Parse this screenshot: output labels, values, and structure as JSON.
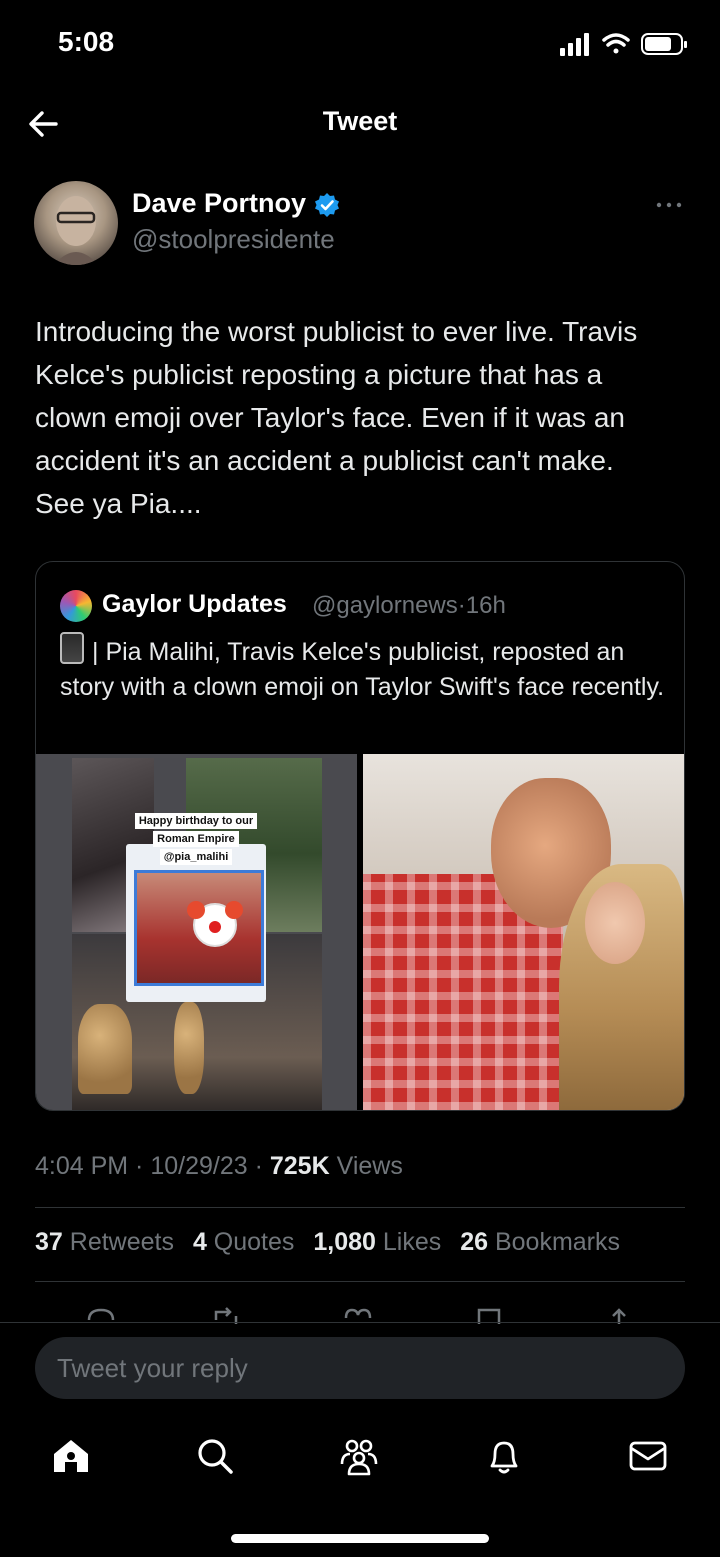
{
  "status_bar": {
    "time": "5:08"
  },
  "header": {
    "title": "Tweet"
  },
  "author": {
    "name": "Dave Portnoy",
    "handle": "@stoolpresidente"
  },
  "tweet": {
    "text": "Introducing the worst publicist to ever live. Travis Kelce's publicist reposting a picture that has a clown emoji over Taylor's face. Even if it was an accident it's an accident a publicist can't make.   See ya Pia...."
  },
  "quote": {
    "name": "Gaylor Updates",
    "handle": "@gaylornews",
    "separator": "·",
    "age": "16h",
    "text": "| Pia Malihi, Travis Kelce's publicist, reposted an story with a clown emoji on Taylor Swift's face recently.",
    "image_left": {
      "caption_line1": "Happy birthday to our",
      "caption_line2": "Roman Empire",
      "caption_line3": "@pia_malihi"
    }
  },
  "meta": {
    "time": "4:04 PM",
    "date": "10/29/23",
    "views_count": "725K",
    "views_label": "Views"
  },
  "stats": {
    "retweets_count": "37",
    "retweets_label": "Retweets",
    "quotes_count": "4",
    "quotes_label": "Quotes",
    "likes_count": "1,080",
    "likes_label": "Likes",
    "bookmarks_count": "26",
    "bookmarks_label": "Bookmarks"
  },
  "reply": {
    "placeholder": "Tweet your reply"
  },
  "icons": {
    "back": "arrow-left-icon",
    "verified": "verified-badge-icon",
    "more": "more-icon",
    "home": "home-icon",
    "search": "search-icon",
    "communities": "communities-icon",
    "notifications": "bell-icon",
    "messages": "mail-icon"
  },
  "colors": {
    "background": "#000000",
    "verified": "#1d9bf0",
    "muted": "#71767b",
    "text": "#e7e9ea"
  }
}
